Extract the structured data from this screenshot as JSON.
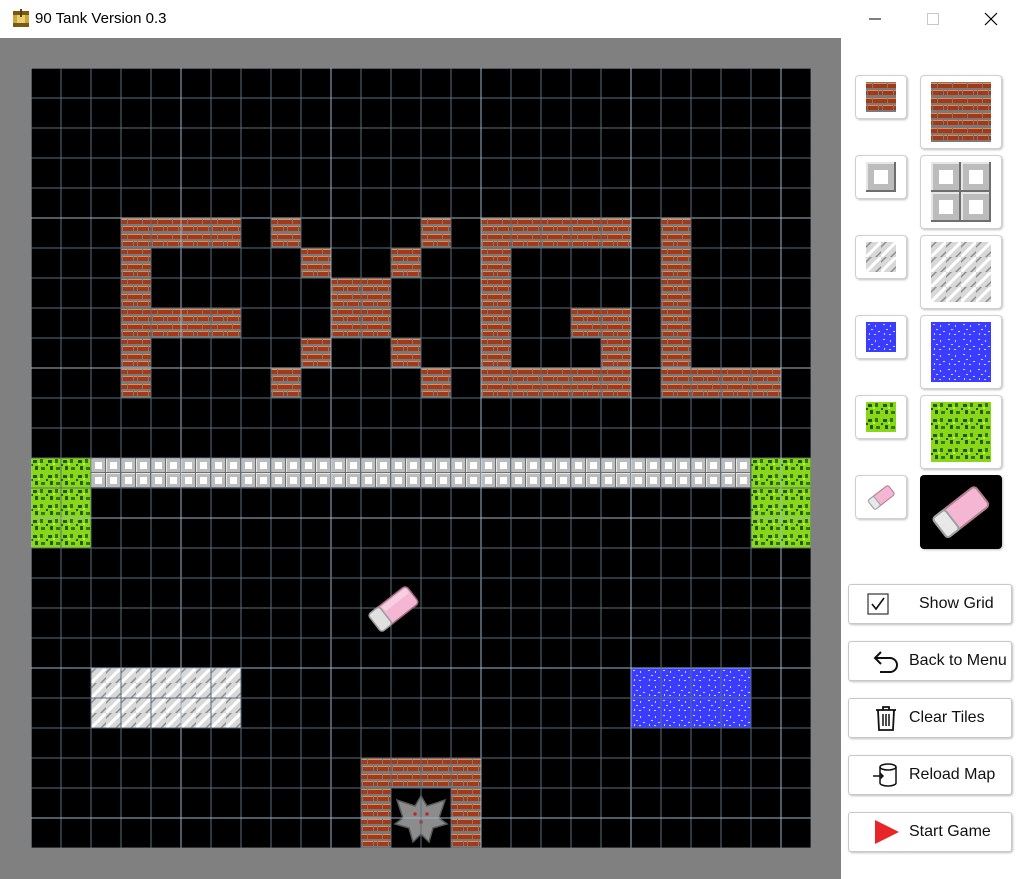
{
  "window": {
    "title": "90 Tank Version 0.3",
    "controls": [
      "minimize",
      "maximize",
      "close"
    ]
  },
  "map": {
    "columns": 26,
    "rows": 26,
    "grid_visible": true,
    "grid_color": "#5a6e7e",
    "grid_major_color": "#9ab6cc",
    "background_color": "#000000",
    "tiles": [
      {
        "type": "brick",
        "col": 3,
        "row": 5,
        "w": 4,
        "h": 1
      },
      {
        "type": "brick",
        "col": 3,
        "row": 6,
        "w": 1,
        "h": 3
      },
      {
        "type": "brick",
        "col": 3,
        "row": 8,
        "w": 4,
        "h": 1
      },
      {
        "type": "brick",
        "col": 3,
        "row": 9,
        "w": 1,
        "h": 2
      },
      {
        "type": "brick",
        "col": 8,
        "row": 5,
        "w": 1,
        "h": 1
      },
      {
        "type": "brick",
        "col": 9,
        "row": 6,
        "w": 1,
        "h": 1
      },
      {
        "type": "brick",
        "col": 10,
        "row": 7,
        "w": 2,
        "h": 2
      },
      {
        "type": "brick",
        "col": 9,
        "row": 9,
        "w": 1,
        "h": 1
      },
      {
        "type": "brick",
        "col": 8,
        "row": 10,
        "w": 1,
        "h": 1
      },
      {
        "type": "brick",
        "col": 13,
        "row": 5,
        "w": 1,
        "h": 1
      },
      {
        "type": "brick",
        "col": 12,
        "row": 6,
        "w": 1,
        "h": 1
      },
      {
        "type": "brick",
        "col": 12,
        "row": 9,
        "w": 1,
        "h": 1
      },
      {
        "type": "brick",
        "col": 13,
        "row": 10,
        "w": 1,
        "h": 1
      },
      {
        "type": "brick",
        "col": 15,
        "row": 5,
        "w": 5,
        "h": 1
      },
      {
        "type": "brick",
        "col": 15,
        "row": 6,
        "w": 1,
        "h": 4
      },
      {
        "type": "brick",
        "col": 15,
        "row": 10,
        "w": 5,
        "h": 1
      },
      {
        "type": "brick",
        "col": 18,
        "row": 8,
        "w": 2,
        "h": 1
      },
      {
        "type": "brick",
        "col": 19,
        "row": 9,
        "w": 1,
        "h": 1
      },
      {
        "type": "brick",
        "col": 21,
        "row": 5,
        "w": 1,
        "h": 5
      },
      {
        "type": "brick",
        "col": 21,
        "row": 10,
        "w": 4,
        "h": 1
      },
      {
        "type": "forest",
        "col": 0,
        "row": 13,
        "w": 2,
        "h": 3
      },
      {
        "type": "steel",
        "col": 2,
        "row": 13,
        "w": 22,
        "h": 1
      },
      {
        "type": "forest",
        "col": 24,
        "row": 13,
        "w": 2,
        "h": 3
      },
      {
        "type": "ice",
        "col": 2,
        "row": 20,
        "w": 5,
        "h": 2
      },
      {
        "type": "water",
        "col": 20,
        "row": 20,
        "w": 4,
        "h": 2
      },
      {
        "type": "brick",
        "col": 11,
        "row": 23,
        "w": 4,
        "h": 1
      },
      {
        "type": "brick",
        "col": 11,
        "row": 24,
        "w": 1,
        "h": 2
      },
      {
        "type": "brick",
        "col": 14,
        "row": 24,
        "w": 1,
        "h": 2
      },
      {
        "type": "eagle",
        "col": 12,
        "row": 24,
        "w": 2,
        "h": 2
      }
    ],
    "cursor": {
      "tool": "eraser",
      "col": 11,
      "row": 17
    }
  },
  "palette": {
    "selected": "eraser",
    "tools": [
      {
        "name": "brick",
        "small_label": "brick-small",
        "large_label": "brick-large"
      },
      {
        "name": "steel",
        "small_label": "steel-small",
        "large_label": "steel-large"
      },
      {
        "name": "ice",
        "small_label": "ice-small",
        "large_label": "ice-large"
      },
      {
        "name": "water",
        "small_label": "water-small",
        "large_label": "water-large"
      },
      {
        "name": "forest",
        "small_label": "forest-small",
        "large_label": "forest-large"
      },
      {
        "name": "eraser",
        "small_label": "eraser-small",
        "large_label": "eraser-large"
      }
    ]
  },
  "actions": {
    "show_grid": "Show Grid",
    "show_grid_checked": true,
    "back_to_menu": "Back to Menu",
    "clear_tiles": "Clear Tiles",
    "reload_map": "Reload Map",
    "start_game": "Start Game"
  },
  "colors": {
    "brick_main": "#a6381a",
    "brick_light": "#e0904c",
    "brick_mortar": "#7a7a7a",
    "steel_light": "#ffffff",
    "steel_mid": "#bcbcbc",
    "steel_dark": "#6e6e6e",
    "water": "#3c3cff",
    "forest_light": "#8cd61a",
    "forest_dark": "#1f5a00",
    "ice": "#d8d8d8",
    "start_red": "#e8262a"
  }
}
